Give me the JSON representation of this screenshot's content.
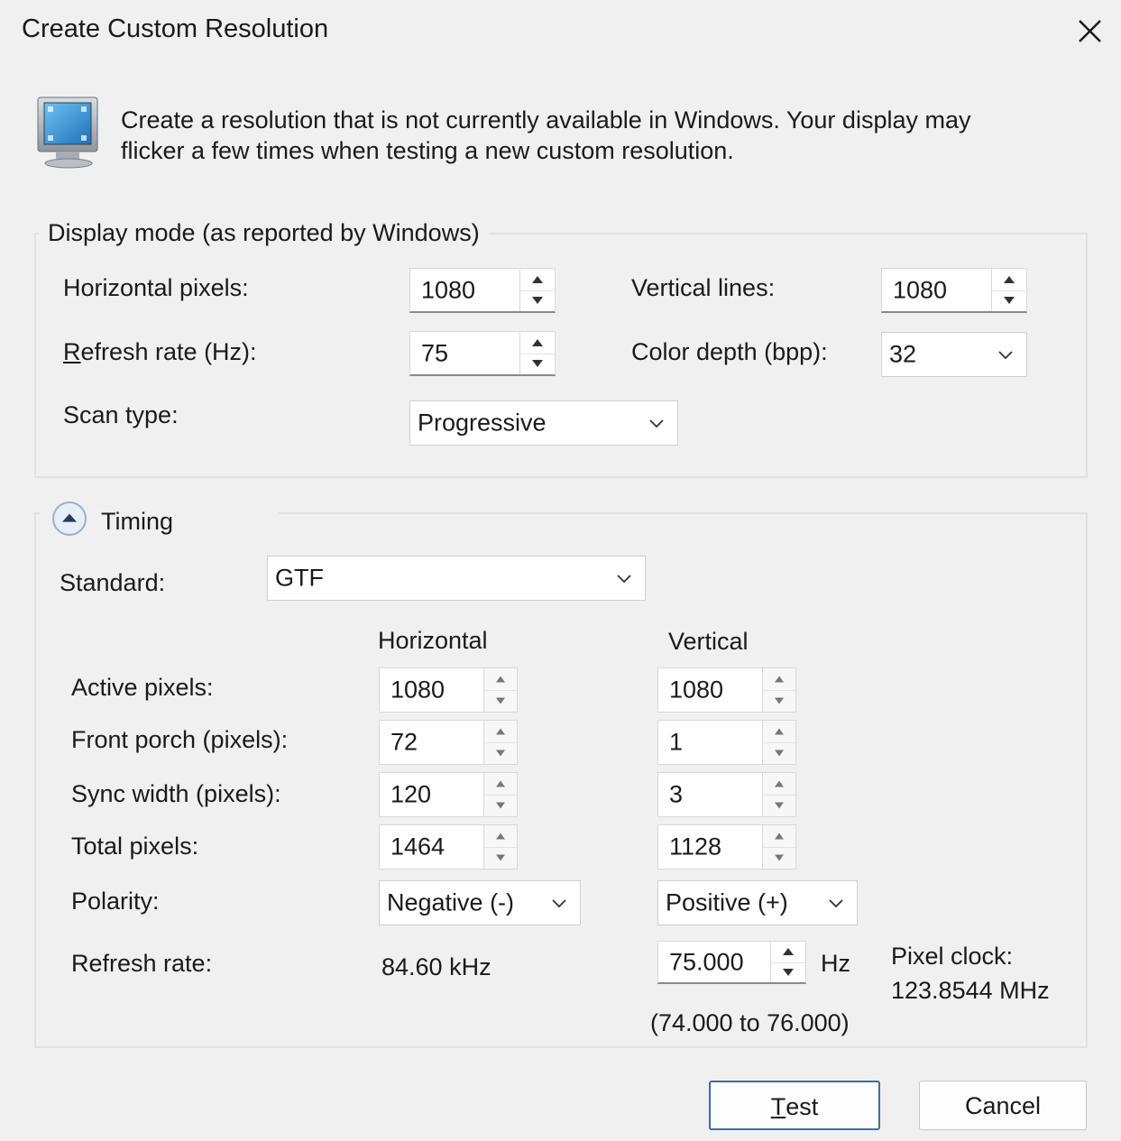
{
  "window": {
    "title": "Create Custom Resolution"
  },
  "icons": {
    "monitor": "monitor-icon",
    "close": "close-icon",
    "collapse": "chevron-up-icon",
    "dropdown": "chevron-down-icon"
  },
  "intro": {
    "line1": "Create a resolution that is not currently available in Windows. Your display may",
    "line2": "flicker a few times when testing a new custom resolution."
  },
  "display_mode": {
    "legend": "Display mode (as reported by Windows)",
    "horizontal_pixels_label": "Horizontal pixels:",
    "horizontal_pixels_value": "1080",
    "vertical_lines_label": "Vertical lines:",
    "vertical_lines_value": "1080",
    "refresh_rate_label_rest": "efresh rate (Hz):",
    "refresh_rate_label_accel": "R",
    "refresh_rate_value": "75",
    "color_depth_label": "Color depth (bpp):",
    "color_depth_value": "32",
    "scan_type_label": "Scan type:",
    "scan_type_value": "Progressive"
  },
  "timing": {
    "legend": "Timing",
    "standard_label": "Standard:",
    "standard_value": "GTF",
    "col_horizontal": "Horizontal",
    "col_vertical": "Vertical",
    "rows": [
      {
        "label": "Active pixels:",
        "h": "1080",
        "v": "1080"
      },
      {
        "label": "Front porch (pixels):",
        "h": "72",
        "v": "1"
      },
      {
        "label": "Sync width (pixels):",
        "h": "120",
        "v": "3"
      },
      {
        "label": "Total pixels:",
        "h": "1464",
        "v": "1128"
      }
    ],
    "polarity_label": "Polarity:",
    "polarity_h": "Negative (-)",
    "polarity_v": "Positive (+)",
    "refresh_label": "Refresh rate:",
    "refresh_h": "84.60 kHz",
    "refresh_v": "75.000",
    "refresh_unit": "Hz",
    "refresh_range": "(74.000 to 76.000)",
    "pixel_clock_label": "Pixel clock:",
    "pixel_clock_value": "123.8544 MHz"
  },
  "buttons": {
    "test_accel": "T",
    "test_rest": "est",
    "cancel": "Cancel"
  }
}
